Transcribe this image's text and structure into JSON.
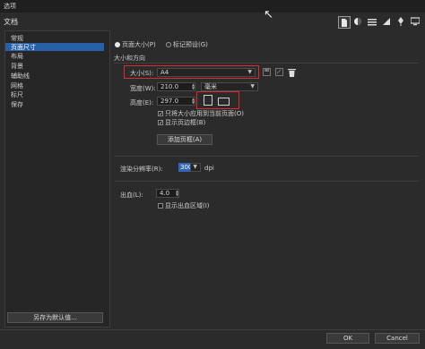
{
  "window": {
    "title": "选项"
  },
  "section": {
    "title": "文档"
  },
  "sidebar": {
    "items": [
      {
        "label": "常规"
      },
      {
        "label": "页面尺寸",
        "selected": true
      },
      {
        "label": "布局"
      },
      {
        "label": "背景"
      },
      {
        "label": "辅助线"
      },
      {
        "label": "网格"
      },
      {
        "label": "标尺"
      },
      {
        "label": "保存"
      }
    ],
    "save_default_label": "另存为默认值..."
  },
  "toolbar": {
    "icons": [
      "document-icon",
      "color-icon",
      "list-icon",
      "ruler-icon",
      "pen-icon",
      "monitor-icon"
    ]
  },
  "page_size": {
    "radio_page_size": "页面大小(P)",
    "radio_label_preset": "标记预设(G)",
    "group_label": "大小和方向",
    "size_label": "大小(S):",
    "size_value": "A4",
    "width_label": "宽度(W):",
    "width_value": "210.0",
    "unit_value": "毫米",
    "height_label": "高度(E):",
    "height_value": "297.0",
    "only_current_label": "只将大小应用到当前页面(O)",
    "show_border_label": "显示页边框(B)",
    "add_frame_label": "添加页框(A)",
    "dpi_label": "渲染分辨率(R):",
    "dpi_value": "300",
    "dpi_unit": "dpi",
    "bleed_label": "出血(L):",
    "bleed_value": "4.0",
    "show_bleed_label": "显示出血区域(I)"
  },
  "footer": {
    "ok_label": "OK",
    "cancel_label": "Cancel"
  },
  "colors": {
    "accent": "#2860a8",
    "highlight": "#e02a2a",
    "background": "#2b2b2b"
  }
}
